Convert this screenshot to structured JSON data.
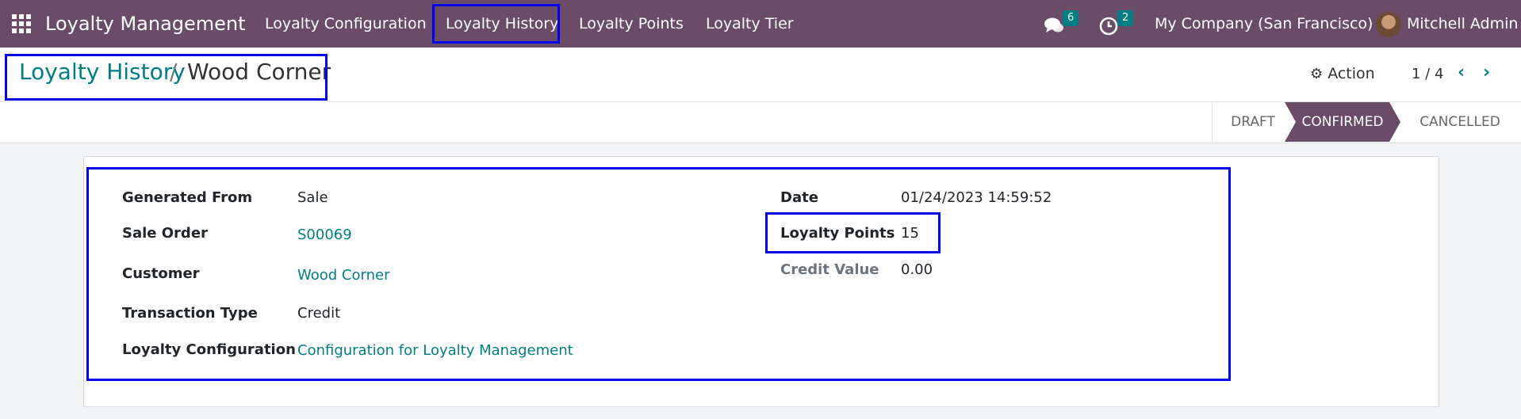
{
  "navbar": {
    "brand": "Loyalty Management",
    "menu": [
      "Loyalty Configuration",
      "Loyalty History",
      "Loyalty Points",
      "Loyalty Tier"
    ],
    "messages_count": "6",
    "activities_count": "2",
    "company": "My Company (San Francisco)",
    "user": "Mitchell Admin"
  },
  "breadcrumb": {
    "parent": "Loyalty History",
    "separator": "/",
    "current": "Wood Corner"
  },
  "control": {
    "action_label": "Action",
    "pager": "1 / 4"
  },
  "status": {
    "stages": [
      "DRAFT",
      "CONFIRMED",
      "CANCELLED"
    ],
    "active": "CONFIRMED"
  },
  "form": {
    "left": [
      {
        "label": "Generated From",
        "value": "Sale"
      },
      {
        "label": "Sale Order",
        "value": "S00069"
      },
      {
        "label": "Customer",
        "value": "Wood Corner"
      },
      {
        "label": "Transaction Type",
        "value": "Credit"
      },
      {
        "label": "Loyalty Configuration",
        "value": "Configuration for Loyalty Management"
      }
    ],
    "right": [
      {
        "label": "Date",
        "value": "01/24/2023 14:59:52"
      },
      {
        "label": "Loyalty Points",
        "value": "15"
      },
      {
        "label": "Credit Value",
        "value": "0.00"
      }
    ]
  },
  "colors": {
    "navbar": "#6a4c68",
    "link": "#017e84",
    "highlight": "#0000ee"
  }
}
